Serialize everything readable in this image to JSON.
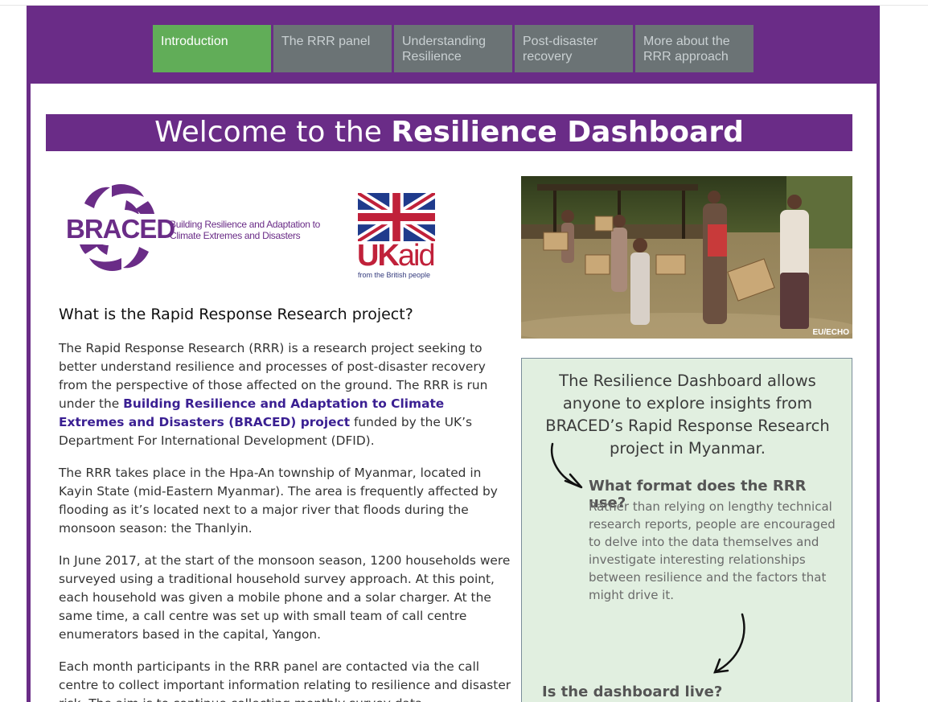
{
  "nav": {
    "tabs": [
      {
        "label": "Introduction",
        "active": true
      },
      {
        "label": "The RRR panel",
        "active": false
      },
      {
        "label": "Understanding Resilience",
        "active": false
      },
      {
        "label": "Post-disaster recovery",
        "active": false
      },
      {
        "label": "More about the RRR approach",
        "active": false
      }
    ]
  },
  "banner": {
    "prefix": "Welcome to the ",
    "strong": "Resilience Dashboard"
  },
  "logos": {
    "braced": {
      "word": "BRACED",
      "tagline": "Building Resilience and Adaptation to Climate Extremes and Disasters"
    },
    "ukaid": {
      "word_uk": "UK",
      "word_aid": "aid",
      "subtitle": "from the British people"
    }
  },
  "photo": {
    "credit": "EU/ECHO"
  },
  "article": {
    "heading": "What is the Rapid Response Research project?",
    "p1_before": "The Rapid Response Research (RRR) is a research project seeking to better understand resilience and processes of post-disaster recovery from the perspective of those affected on the ground. The RRR is run under the ",
    "p1_link": "Building Resilience and Adaptation to Climate Extremes and Disasters (BRACED) project",
    "p1_after": " funded by the UK’s Department For International Development (DFID).",
    "p2": "The RRR takes place in the Hpa-An township of Myanmar, located in Kayin State (mid-Eastern Myanmar). The area is frequently affected by flooding as it’s located next to a major river that floods during the monsoon season: the Thanlyin.",
    "p3": "In June 2017, at the start of the monsoon season, 1200 households were surveyed using a traditional household survey approach. At this point, each household was given a mobile phone and a solar charger. At the same time, a call centre was set up with small team of call centre enumerators based in the capital, Yangon.",
    "p4": "Each month participants in the RRR panel are contacted via the call centre to collect important information relating to resilience and disaster risk. The aim is to continue collecting monthly survey data"
  },
  "sidebox": {
    "intro": "The Resilience Dashboard allows anyone to explore insights from BRACED’s Rapid Response Research project in Myanmar.",
    "q1": "What format does the RRR use?",
    "a1": "Rather than relying on lengthy technical research reports, people are encouraged to delve into the data themselves and investigate interesting relationships between resilience and the factors that might drive it.",
    "q2": "Is the dashboard live?"
  },
  "colors": {
    "purple": "#6a2c87",
    "nav_active": "#61ad58",
    "nav_inactive": "#6b7375",
    "box_bg": "#e1efe0",
    "link": "#3a1f92"
  }
}
